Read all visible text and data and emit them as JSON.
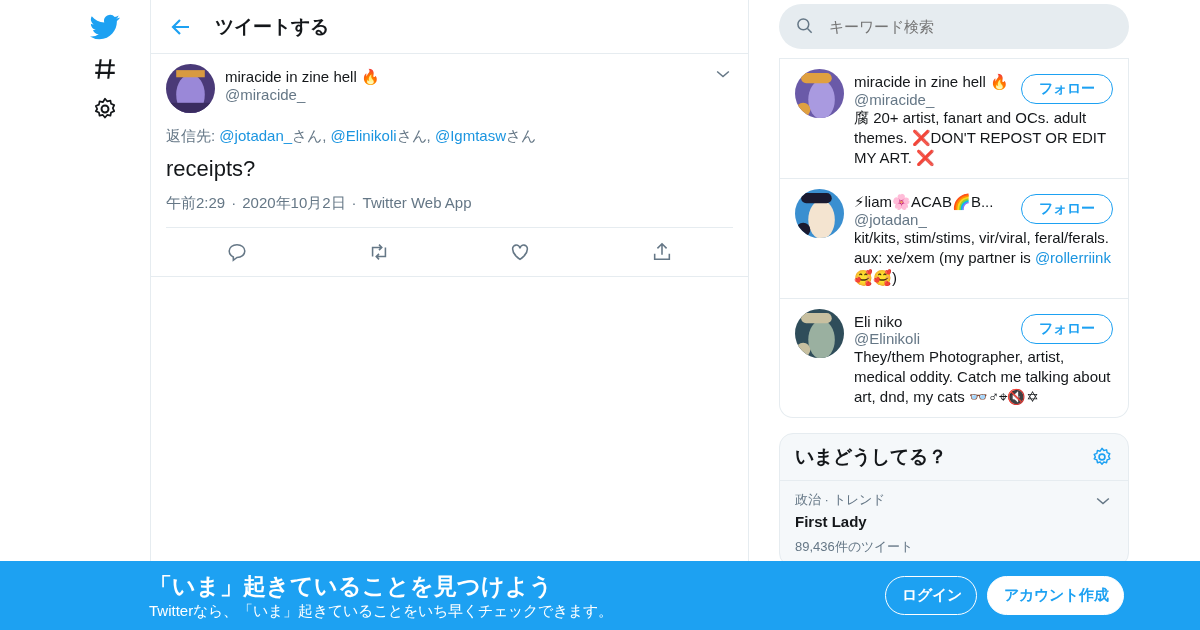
{
  "header": {
    "title": "ツイートする"
  },
  "tweet": {
    "name": "miracide in zine hell 🔥",
    "handle": "@miracide_",
    "reply": {
      "prefix": "返信先: ",
      "mentions": [
        {
          "handle": "@jotadan_",
          "suffix": "さん, "
        },
        {
          "handle": "@Elinikoli",
          "suffix": "さん, "
        },
        {
          "handle": "@Igmtasw",
          "suffix": "さん"
        }
      ]
    },
    "text": "receipts?",
    "meta": [
      "午前2:29",
      "2020年10月2日",
      "Twitter Web App"
    ],
    "meta_separator": "·"
  },
  "search": {
    "placeholder": "キーワード検索"
  },
  "who_to_follow": [
    {
      "name": "miracide in zine hell 🔥",
      "handle": "@miracide_",
      "button": "フォロー",
      "bio": "腐 20+ artist, fanart and OCs. adult themes. ❌DON'T REPOST OR EDIT MY ART. ❌"
    },
    {
      "name": "⚡liam🌸ACAB🌈B...",
      "handle": "@jotadan_",
      "button": "フォロー",
      "bio": "kit/kits, stim/stims, vir/viral, feral/ferals. aux: xe/xem (my partner is ",
      "bio_mention": "@rollerriink",
      "bio_end": " 🥰🥰)"
    },
    {
      "name": "Eli niko",
      "handle": "@Elinikoli",
      "button": "フォロー",
      "bio": "They/them Photographer, artist, medical oddity. Catch me talking about art, dnd, my cats 👓♂⌖🔇✡"
    }
  ],
  "trends": {
    "title": "いまどうしてる？",
    "items": [
      {
        "context": "政治 · トレンド",
        "name": "First Lady",
        "count": "89,436件のツイート"
      }
    ]
  },
  "banner": {
    "title": "「いま」起きていることを見つけよう",
    "subtitle": "Twitterなら、「いま」起きていることをいち早くチェックできます。",
    "login": "ログイン",
    "signup": "アカウント作成"
  }
}
